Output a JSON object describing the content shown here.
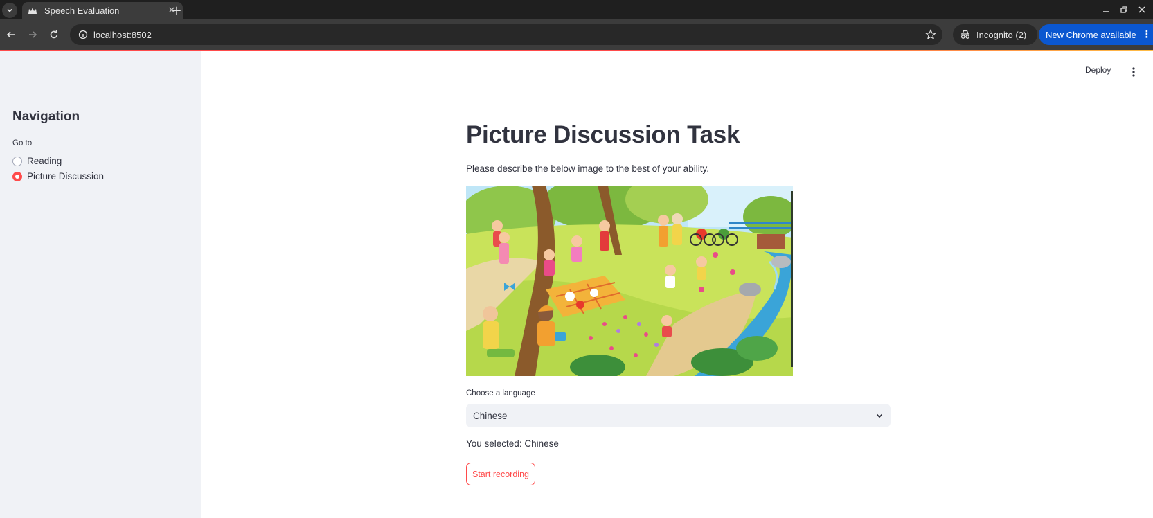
{
  "browser": {
    "tab_title": "Speech Evaluation",
    "url": "localhost:8502",
    "incognito_label": "Incognito (2)",
    "update_label": "New Chrome available",
    "icons": {
      "tab_list": "chevron-down-icon",
      "favicon": "streamlit-crown-icon",
      "close": "close-icon",
      "new_tab": "plus-icon",
      "back": "arrow-left-icon",
      "forward": "arrow-right-icon",
      "reload": "reload-icon",
      "site_info": "info-icon",
      "bookmark": "star-icon",
      "incognito": "incognito-icon"
    }
  },
  "app": {
    "deploy_label": "Deploy",
    "menu_icon": "kebab-icon",
    "accent_color": "#ff4b4b",
    "sidebar_bg": "#f0f2f6",
    "text_color": "#31333f"
  },
  "sidebar": {
    "title": "Navigation",
    "radio_label": "Go to",
    "options": [
      {
        "label": "Reading",
        "checked": false
      },
      {
        "label": "Picture Discussion",
        "checked": true
      }
    ]
  },
  "main": {
    "title": "Picture Discussion Task",
    "instructions": "Please describe the below image to the best of your ability.",
    "image_description": "cartoon-park-picnic-scene",
    "language_label": "Choose a language",
    "language_value": "Chinese",
    "selected_text": "You selected: Chinese",
    "record_button": "Start recording"
  }
}
